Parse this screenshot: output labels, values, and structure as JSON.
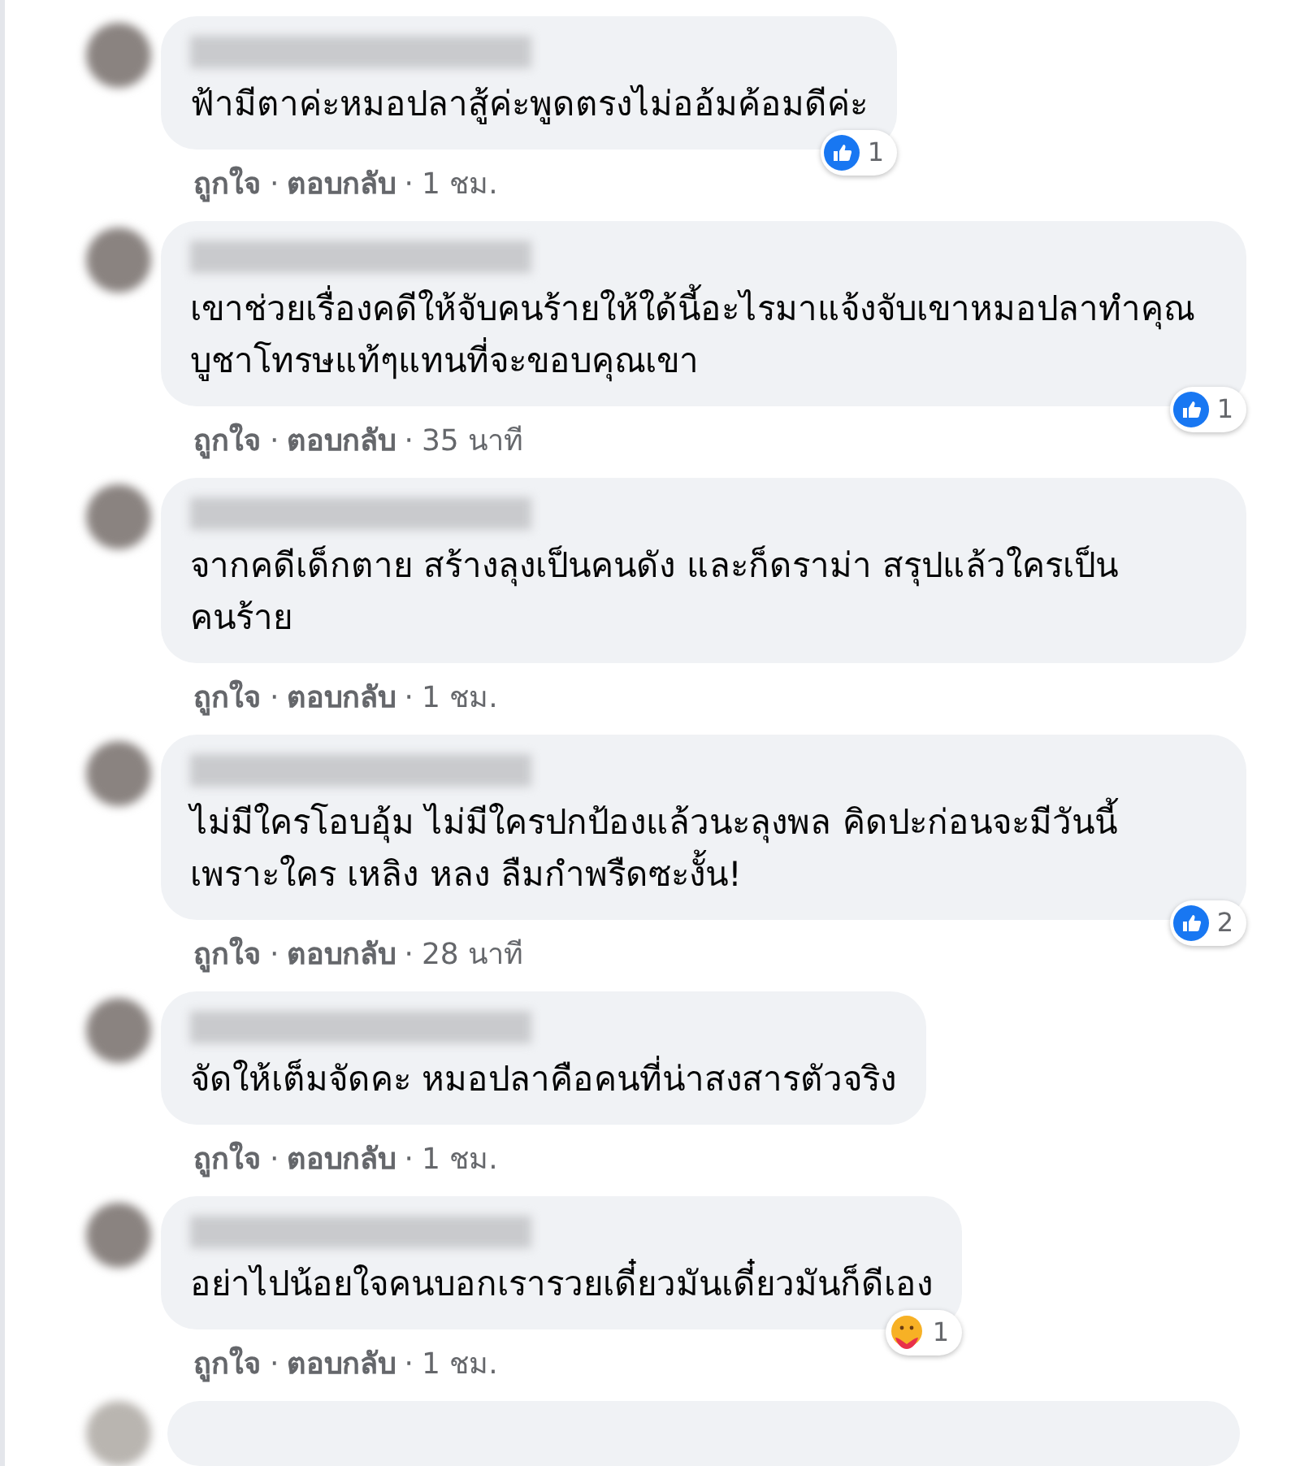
{
  "separator": "·",
  "comments": [
    {
      "text": "ฟ้ามีตาค่ะหมอปลาสู้ค่ะพูดตรงไม่ออ้มค้อมดีค่ะ",
      "actions": [
        "ถูกใจ",
        "ตอบกลับ"
      ],
      "time": "1 ชม.",
      "reaction": {
        "kind": "like",
        "count": "1"
      }
    },
    {
      "text": "เขาช่วยเรื่องคดีให้จับคนร้ายให้ใด้นี้อะไรมาแจ้งจับเขาหมอปลาทำคุณบูชาโทรษแท้ๆแทนที่จะขอบคุณเขา",
      "actions": [
        "ถูกใจ",
        "ตอบกลับ"
      ],
      "time": "35 นาที",
      "reaction": {
        "kind": "like",
        "count": "1"
      }
    },
    {
      "text": "จากคดีเด็กตาย สร้างลุงเป็นคนดัง และก็ดราม่า สรุปแล้วใครเป็นคนร้าย",
      "actions": [
        "ถูกใจ",
        "ตอบกลับ"
      ],
      "time": "1 ชม."
    },
    {
      "text": "ไม่มีใครโอบอุ้ม ไม่มีใครปกป้องแล้วนะลุงพล คิดปะก่อนจะมีวันนี้ เพราะใคร เหลิง หลง ลืมกำพรืดซะงั้น!",
      "actions": [
        "ถูกใจ",
        "ตอบกลับ"
      ],
      "time": "28 นาที",
      "reaction": {
        "kind": "like",
        "count": "2"
      }
    },
    {
      "text": "จัดให้เต็มจัดคะ หมอปลาคือคนที่น่าสงสารตัวจริง",
      "actions": [
        "ถูกใจ",
        "ตอบกลับ"
      ],
      "time": "1 ชม."
    },
    {
      "text": "อย่าไปน้อยใจคนบอกเรารวยเดี๋ยวมันเดี๋ยวมันก็ดีเอง",
      "actions": [
        "ถูกใจ",
        "ตอบกลับ"
      ],
      "time": "1 ชม.",
      "reaction": {
        "kind": "care",
        "count": "1"
      }
    }
  ]
}
